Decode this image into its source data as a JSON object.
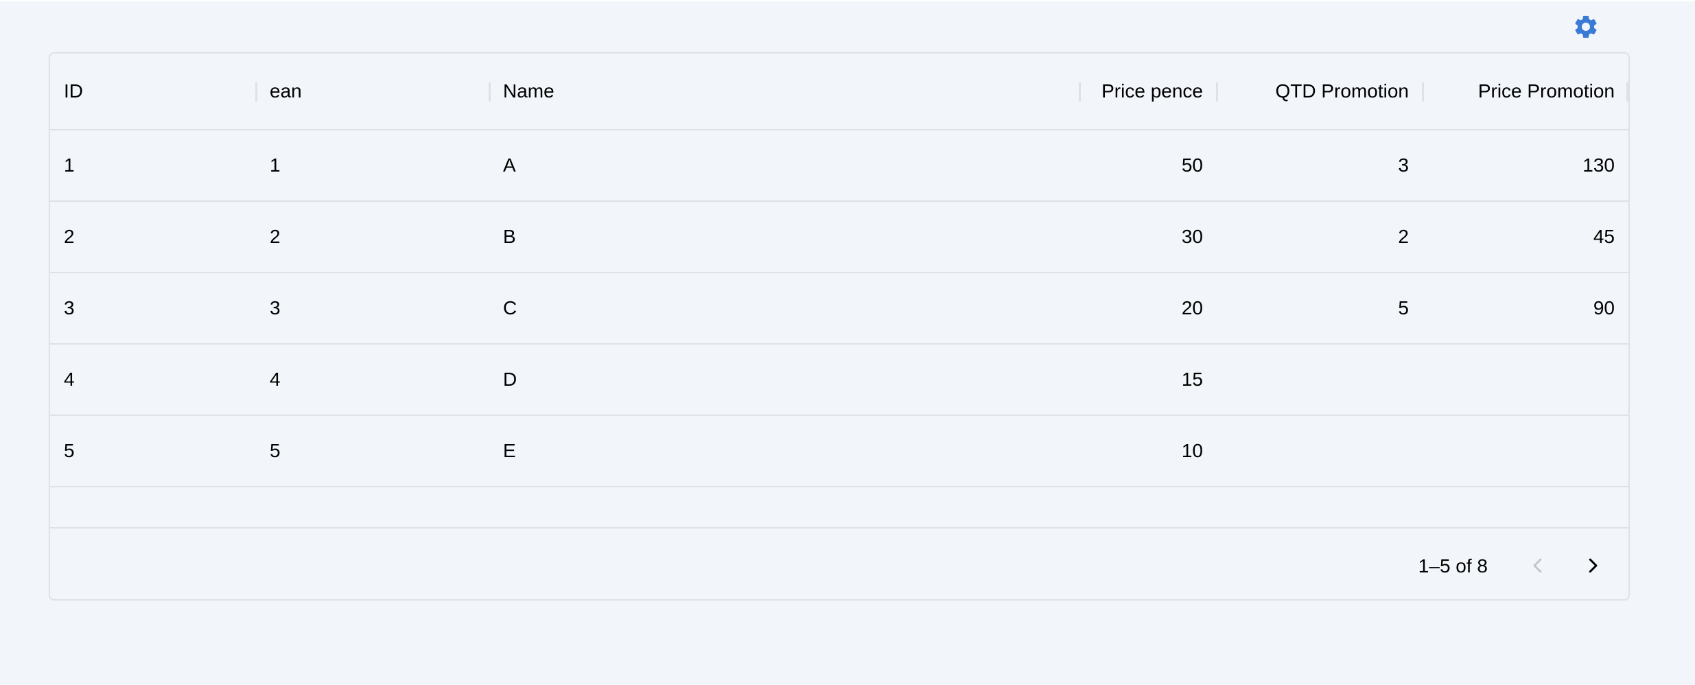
{
  "toolbar": {
    "settings_icon": "gear-icon",
    "accent_color": "#3a7bd5"
  },
  "table": {
    "columns": [
      {
        "label": "ID",
        "align": "left"
      },
      {
        "label": "ean",
        "align": "left"
      },
      {
        "label": "Name",
        "align": "left"
      },
      {
        "label": "Price pence",
        "align": "right"
      },
      {
        "label": "QTD Promotion",
        "align": "right"
      },
      {
        "label": "Price Promotion",
        "align": "right"
      }
    ],
    "rows": [
      [
        "1",
        "1",
        "A",
        "50",
        "3",
        "130"
      ],
      [
        "2",
        "2",
        "B",
        "30",
        "2",
        "45"
      ],
      [
        "3",
        "3",
        "C",
        "20",
        "5",
        "90"
      ],
      [
        "4",
        "4",
        "D",
        "15",
        "",
        ""
      ],
      [
        "5",
        "5",
        "E",
        "10",
        "",
        ""
      ]
    ]
  },
  "pagination": {
    "range_text": "1–5 of 8",
    "prev_icon": "chevron-left-icon",
    "next_icon": "chevron-right-icon",
    "prev_disabled": true
  }
}
